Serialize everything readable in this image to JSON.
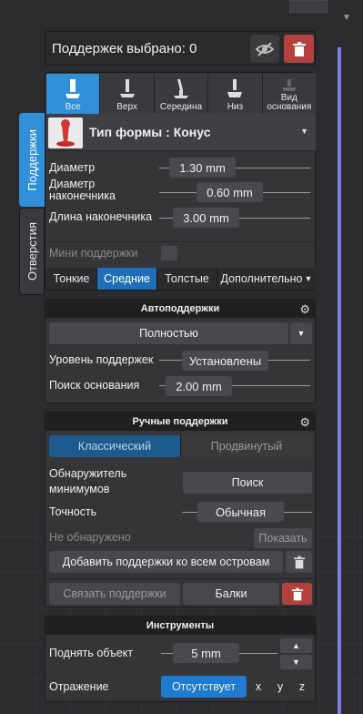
{
  "header": {
    "title": "Поддержек выбрано: 0"
  },
  "side_tabs": [
    "Поддержки",
    "Отверстия"
  ],
  "support_tabs": [
    {
      "label": "Все",
      "icon": "support-all-icon",
      "active": true
    },
    {
      "label": "Верх",
      "icon": "support-top-icon",
      "active": false
    },
    {
      "label": "Середина",
      "icon": "support-middle-icon",
      "active": false
    },
    {
      "label": "Низ",
      "icon": "support-bottom-icon",
      "active": false
    },
    {
      "label": "Вид основания",
      "icon": "support-base-icon",
      "active": false
    }
  ],
  "shape": {
    "label": "Тип формы : Конус"
  },
  "params": {
    "diameter_label": "Диаметр",
    "diameter_value": "1.30 mm",
    "tip_diameter_label_1": "Диаметр",
    "tip_diameter_label_2": "наконечника",
    "tip_diameter_value": "0.60 mm",
    "tip_length_label": "Длина наконечника",
    "tip_length_value": "3.00 mm",
    "mini_label": "Мини поддержки"
  },
  "density_tabs": [
    "Тонкие",
    "Средние",
    "Толстые",
    "Дополнительно"
  ],
  "density_active": 1,
  "auto": {
    "title": "Автоподдержки",
    "mode": "Полностью",
    "level_label": "Уровень поддержек",
    "level_value": "Установлены",
    "base_label": "Поиск основания",
    "base_value": "2.00 mm"
  },
  "manual": {
    "title": "Ручные поддержки",
    "tabs": [
      "Классический",
      "Продвинутый"
    ],
    "detector_label_1": "Обнаружитель",
    "detector_label_2": "минимумов",
    "search_button": "Поиск",
    "accuracy_label": "Точность",
    "accuracy_value": "Обычная",
    "not_found": "Не обнаружено",
    "show_button": "Показать",
    "add_islands": "Добавить поддержки ко всем островам",
    "link_supports": "Связать поддержки",
    "beams": "Балки"
  },
  "tools": {
    "title": "Инструменты",
    "lift_label": "Поднять объект",
    "lift_value": "5 mm",
    "mirror_label": "Отражение",
    "mirror_value": "Отсутствует",
    "axes": [
      "x",
      "y",
      "z"
    ]
  },
  "colors": {
    "accent": "#2f8fd8",
    "danger": "#b2413d",
    "viewport_line": "#7b7fe6"
  }
}
